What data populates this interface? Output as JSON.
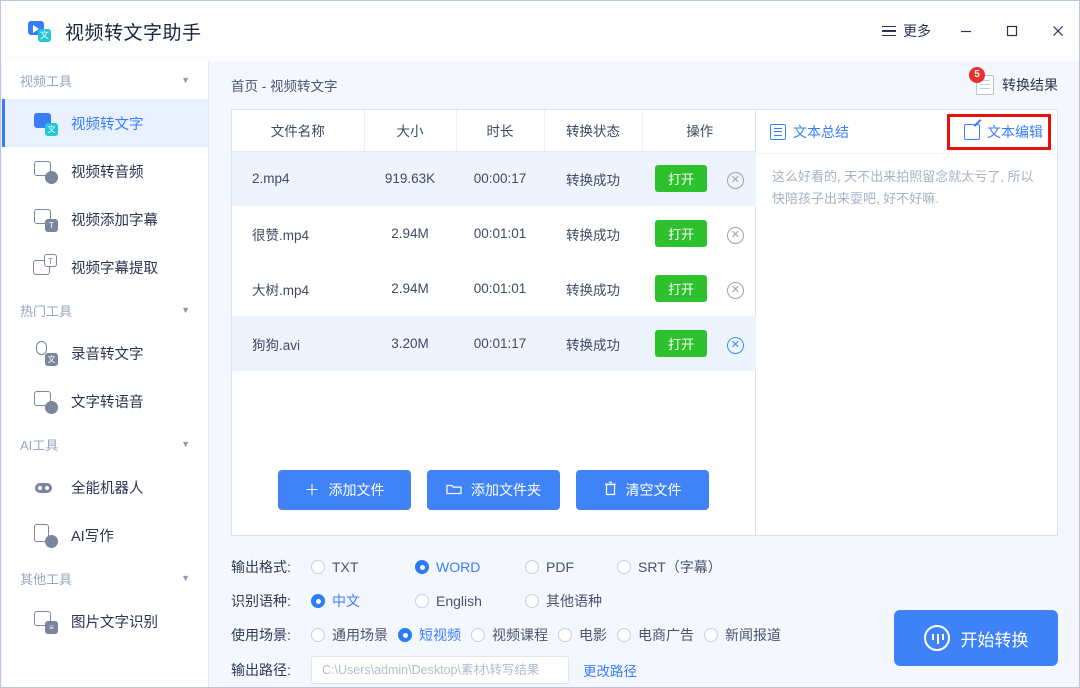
{
  "titlebar": {
    "app_title": "视频转文字助手",
    "logo_mark": "video-translate-logo",
    "more_label": "更多",
    "minimize_label": "–",
    "maximize_label": "□",
    "close_label": "✕"
  },
  "sidebar": {
    "groups": [
      {
        "label": "视频工具",
        "items": [
          {
            "label": "视频转文字",
            "icon": "video-to-text-icon",
            "active": true
          },
          {
            "label": "视频转音频",
            "icon": "video-to-audio-icon",
            "active": false
          },
          {
            "label": "视频添加字幕",
            "icon": "add-subtitle-icon",
            "active": false
          },
          {
            "label": "视频字幕提取",
            "icon": "extract-subtitle-icon",
            "active": false
          }
        ]
      },
      {
        "label": "热门工具",
        "items": [
          {
            "label": "录音转文字",
            "icon": "audio-to-text-icon",
            "active": false
          },
          {
            "label": "文字转语音",
            "icon": "text-to-speech-icon",
            "active": false
          }
        ]
      },
      {
        "label": "AI工具",
        "items": [
          {
            "label": "全能机器人",
            "icon": "robot-icon",
            "active": false
          },
          {
            "label": "AI写作",
            "icon": "ai-writing-icon",
            "active": false
          }
        ]
      },
      {
        "label": "其他工具",
        "items": [
          {
            "label": "图片文字识别",
            "icon": "image-ocr-icon",
            "active": false
          }
        ]
      }
    ]
  },
  "content": {
    "breadcrumb": "首页 - 视频转文字",
    "result_link": {
      "label": "转换结果",
      "badge": "5",
      "icon": "document-icon"
    }
  },
  "table": {
    "headers": [
      "文件名称",
      "大小",
      "时长",
      "转换状态",
      "操作"
    ],
    "rows": [
      {
        "name": "2.mp4",
        "size": "919.63K",
        "duration": "00:00:17",
        "status": "转换成功",
        "action": "打开"
      },
      {
        "name": "很赞.mp4",
        "size": "2.94M",
        "duration": "00:01:01",
        "status": "转换成功",
        "action": "打开"
      },
      {
        "name": "大树.mp4",
        "size": "2.94M",
        "duration": "00:01:01",
        "status": "转换成功",
        "action": "打开"
      },
      {
        "name": "狗狗.avi",
        "size": "3.20M",
        "duration": "00:01:17",
        "status": "转换成功",
        "action": "打开"
      }
    ],
    "delete_icon": "✕"
  },
  "file_actions": [
    {
      "label": "添加文件",
      "icon": "plus-icon",
      "glyph": "＋"
    },
    {
      "label": "添加文件夹",
      "icon": "folder-icon",
      "glyph": "▭"
    },
    {
      "label": "清空文件",
      "icon": "trash-icon",
      "glyph": "🗑"
    }
  ],
  "right_pane": {
    "tab_summary": {
      "label": "文本总结",
      "icon": "summary-icon"
    },
    "tab_edit": {
      "label": "文本编辑",
      "icon": "edit-pencil-icon",
      "highlighted": true
    },
    "transcript": "这么好看的, 天不出来拍照留念就太亏了, 所以快陪孩子出来耍吧, 好不好嘛."
  },
  "options": {
    "format": {
      "label": "输出格式:",
      "choices": [
        {
          "label": "TXT",
          "selected": false
        },
        {
          "label": "WORD",
          "selected": true
        },
        {
          "label": "PDF",
          "selected": false
        },
        {
          "label": "SRT（字幕）",
          "selected": false
        }
      ]
    },
    "language": {
      "label": "识别语种:",
      "choices": [
        {
          "label": "中文",
          "selected": true
        },
        {
          "label": "English",
          "selected": false
        },
        {
          "label": "其他语种",
          "selected": false
        }
      ]
    },
    "scene": {
      "label": "使用场景:",
      "choices": [
        {
          "label": "通用场景",
          "selected": false
        },
        {
          "label": "短视频",
          "selected": true
        },
        {
          "label": "视频课程",
          "selected": false
        },
        {
          "label": "电影",
          "selected": false
        },
        {
          "label": "电商广告",
          "selected": false
        },
        {
          "label": "新闻报道",
          "selected": false
        }
      ]
    },
    "output_path": {
      "label": "输出路径:",
      "value": "C:\\Users\\admin\\Desktop\\素材\\转写结果",
      "change_label": "更改路径"
    }
  },
  "start_button": {
    "label": "开始转换",
    "icon": "convert-icon"
  },
  "colors": {
    "accent": "#3a7dfc",
    "button_blue": "#4083f7",
    "open_green": "#2ec12e",
    "badge_red": "#e8312a",
    "highlight_red": "#e8100b",
    "row_alt": "#eef4fd",
    "page_bg": "#f4f7fd"
  }
}
